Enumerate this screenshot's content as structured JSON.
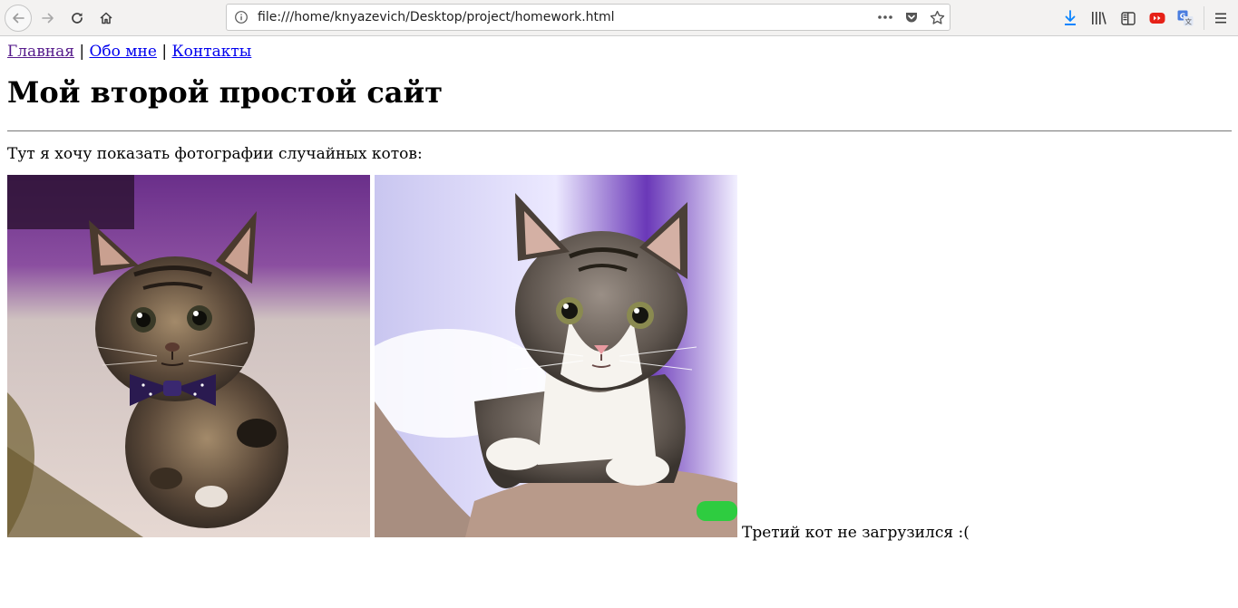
{
  "browser": {
    "url": "file:///home/knyazevich/Desktop/project/homework.html"
  },
  "nav": {
    "home": "Главная",
    "about": "Обо мне",
    "contacts": "Контакты",
    "separator": "|"
  },
  "page": {
    "title": "Мой второй простой сайт",
    "intro": "Тут я хочу показать фотографии случайных котов:",
    "missing_cat": "Третий кот не загрузился :("
  },
  "icons": {
    "back": "back-arrow-icon",
    "forward": "forward-arrow-icon",
    "reload": "reload-icon",
    "home": "home-icon",
    "info": "info-icon",
    "more": "more-dots-icon",
    "pocket": "pocket-icon",
    "bookmark": "star-icon",
    "downloads": "download-icon",
    "library": "library-icon",
    "sidebar": "sidebar-icon",
    "youtube": "youtube-icon",
    "translate": "translate-icon",
    "menu": "hamburger-menu-icon"
  },
  "colors": {
    "link": "#0000ee",
    "visited_link": "#551a8b",
    "download_accent": "#0a84ff",
    "youtube_red": "#e62117",
    "translate_blue": "#4a7ddf"
  }
}
